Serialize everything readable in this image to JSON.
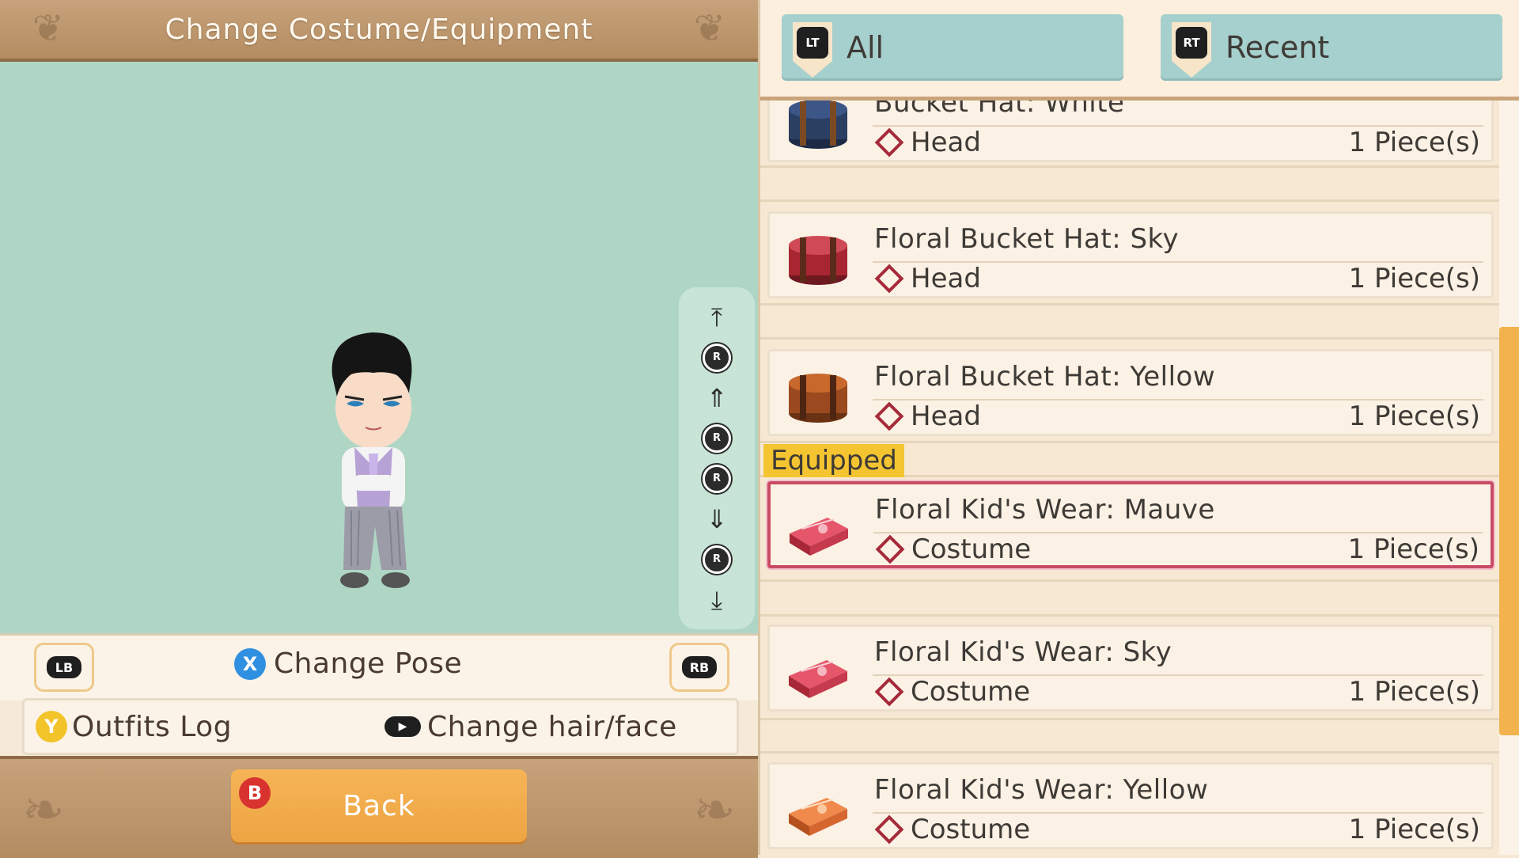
{
  "header": {
    "title": "Change Costume/Equipment"
  },
  "controls": {
    "lb": "LB",
    "rb": "RB",
    "change_pose": {
      "button": "X",
      "label": "Change Pose"
    },
    "outfits_log": {
      "button": "Y",
      "label": "Outfits Log"
    },
    "change_hair_face": {
      "label": "Change hair/face"
    },
    "back": {
      "button": "B",
      "label": "Back"
    },
    "rail": {
      "r_label": "R"
    }
  },
  "tabs": [
    {
      "button": "LT",
      "label": "All"
    },
    {
      "button": "RT",
      "label": "Recent"
    }
  ],
  "equipped_label": "Equipped",
  "items": [
    {
      "name": "Bucket Hat: White",
      "slot": "Head",
      "qty": "1 Piece(s)",
      "icon": "hatbox-navy-icon",
      "color": "#2b3f63"
    },
    {
      "name": "Floral Bucket Hat: Sky",
      "slot": "Head",
      "qty": "1 Piece(s)",
      "icon": "hatbox-red-icon",
      "color": "#a82632"
    },
    {
      "name": "Floral Bucket Hat: Yellow",
      "slot": "Head",
      "qty": "1 Piece(s)",
      "icon": "hatbox-brown-icon",
      "color": "#9a4a1e"
    },
    {
      "name": "Floral Kid's Wear: Mauve",
      "slot": "Costume",
      "qty": "1 Piece(s)",
      "icon": "suitcase-red-icon",
      "color": "#d9384a"
    },
    {
      "name": "Floral Kid's Wear: Sky",
      "slot": "Costume",
      "qty": "1 Piece(s)",
      "icon": "suitcase-red-icon",
      "color": "#d9384a"
    },
    {
      "name": "Floral Kid's Wear: Yellow",
      "slot": "Costume",
      "qty": "1 Piece(s)",
      "icon": "suitcase-orange-icon",
      "color": "#e7703a"
    }
  ],
  "colors": {
    "accent_orange": "#f2b24d",
    "tab_teal": "#a6d0cd",
    "stage_green": "#afd6c5",
    "equipped_border": "#c94c64",
    "equipped_tag": "#f4c431"
  }
}
